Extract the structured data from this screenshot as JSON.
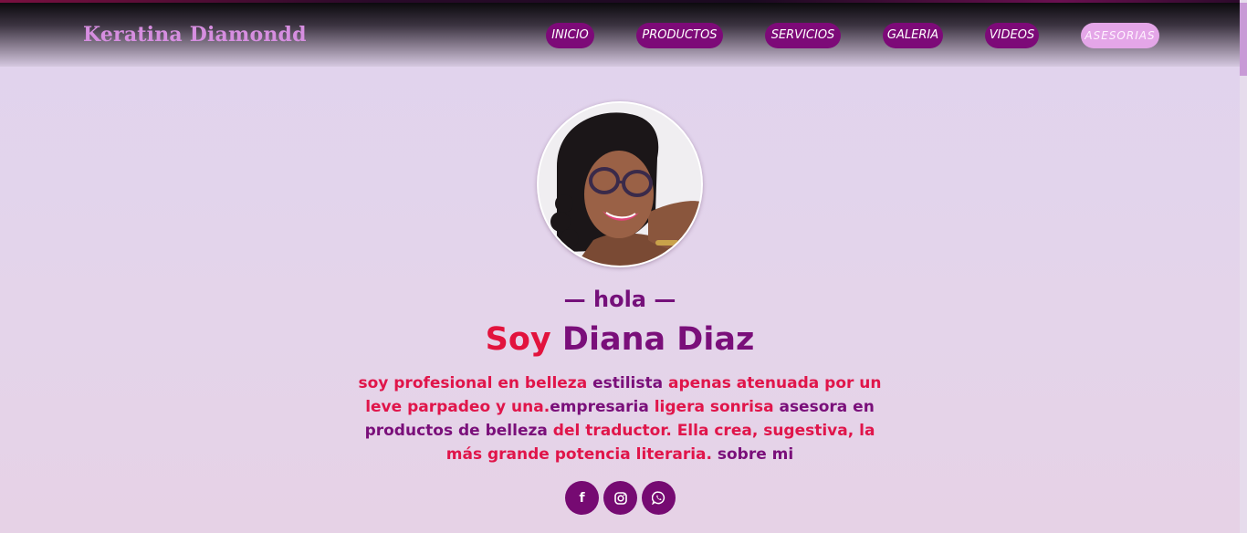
{
  "header": {
    "brand": "Keratina Diamondd",
    "nav": [
      {
        "label": "INICIO"
      },
      {
        "label": "PRODUCTOS"
      },
      {
        "label": "SERVICIOS"
      },
      {
        "label": "GALERIA"
      },
      {
        "label": "VIDEOS"
      },
      {
        "label": "ASESORIAS",
        "active": true
      }
    ]
  },
  "hero": {
    "greeting": "— hola —",
    "name_prefix": "Soy",
    "name": "Diana Diaz",
    "bio": [
      {
        "text": "soy profesional en belleza ",
        "tone": "red"
      },
      {
        "text": "estilista ",
        "tone": "purple"
      },
      {
        "text": "apenas atenuada por un leve parpadeo y una.",
        "tone": "red"
      },
      {
        "text": "empresaria ",
        "tone": "purple"
      },
      {
        "text": "ligera sonrisa ",
        "tone": "red"
      },
      {
        "text": "asesora en productos de belleza ",
        "tone": "purple"
      },
      {
        "text": "del traductor. Ella crea, sugestiva, la más grande potencia literaria. ",
        "tone": "red"
      },
      {
        "text": "sobre mi",
        "tone": "purple"
      }
    ]
  },
  "socials": [
    {
      "icon": "facebook-icon",
      "glyph": "f"
    },
    {
      "icon": "instagram-icon",
      "glyph": ""
    },
    {
      "icon": "whatsapp-icon",
      "glyph": ""
    }
  ],
  "colors": {
    "accent_purple": "#7d0a78",
    "accent_red": "#e2133d",
    "brand_pink": "#d68ee0",
    "active_nav": "#e4a6e8",
    "background": "#e0d3ee"
  }
}
